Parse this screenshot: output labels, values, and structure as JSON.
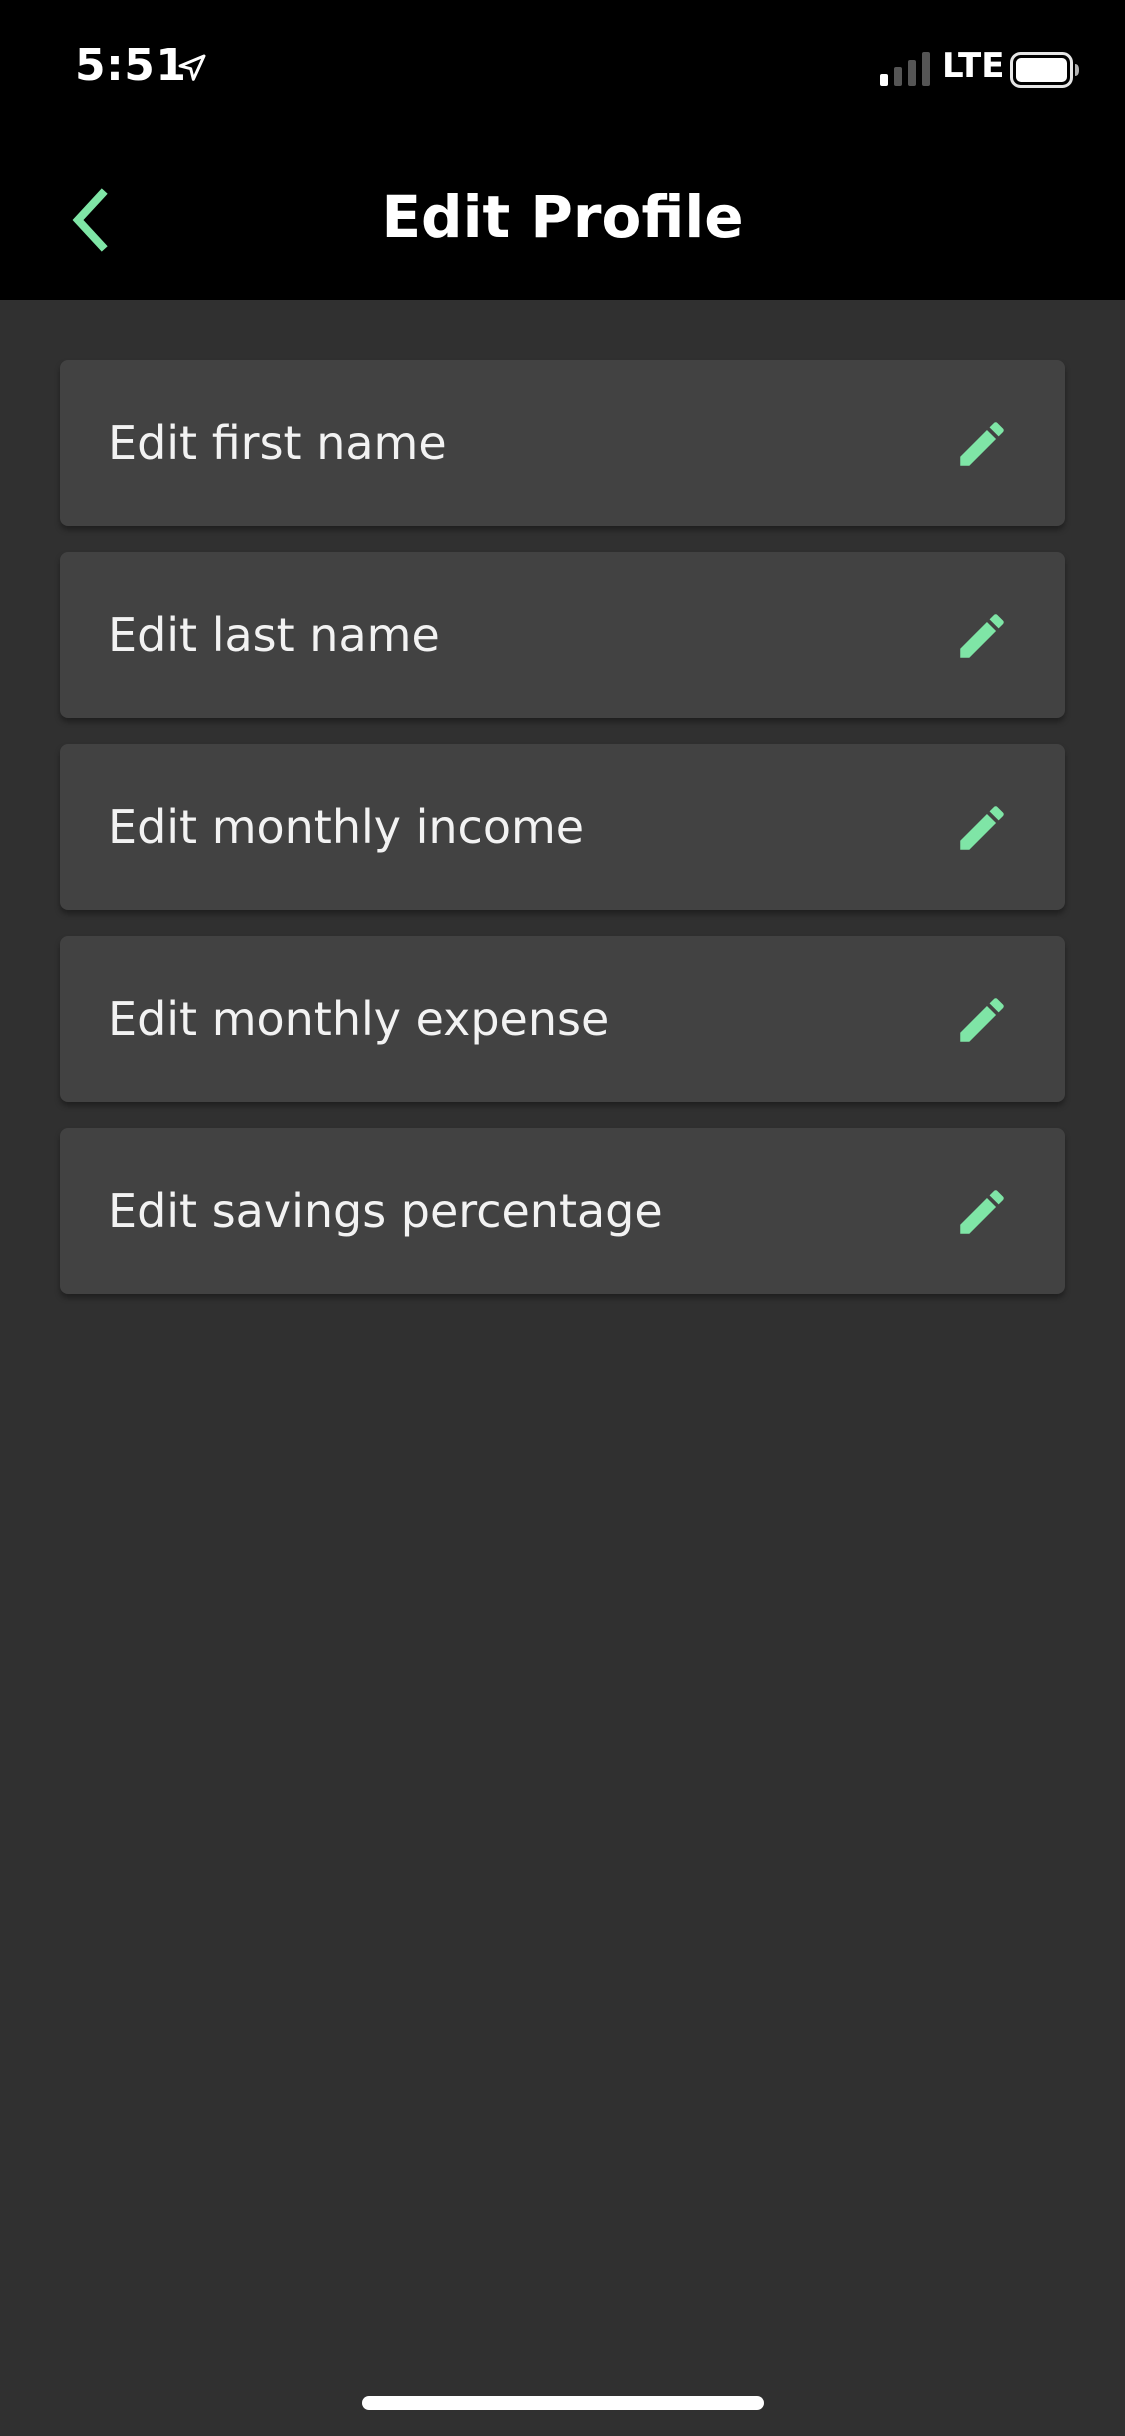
{
  "status_bar": {
    "time": "5:51",
    "network": "LTE"
  },
  "header": {
    "title": "Edit Profile"
  },
  "items": [
    {
      "label": "Edit first name"
    },
    {
      "label": "Edit last name"
    },
    {
      "label": "Edit monthly income"
    },
    {
      "label": "Edit monthly expense"
    },
    {
      "label": "Edit savings percentage"
    }
  ],
  "colors": {
    "accent": "#7fe5a6",
    "background": "#303030",
    "card": "#424242",
    "header": "#000000"
  },
  "icons": {
    "back": "chevron-left-icon",
    "edit": "pencil-icon",
    "location": "location-arrow-icon",
    "signal": "cellular-signal-icon",
    "battery": "battery-icon"
  }
}
